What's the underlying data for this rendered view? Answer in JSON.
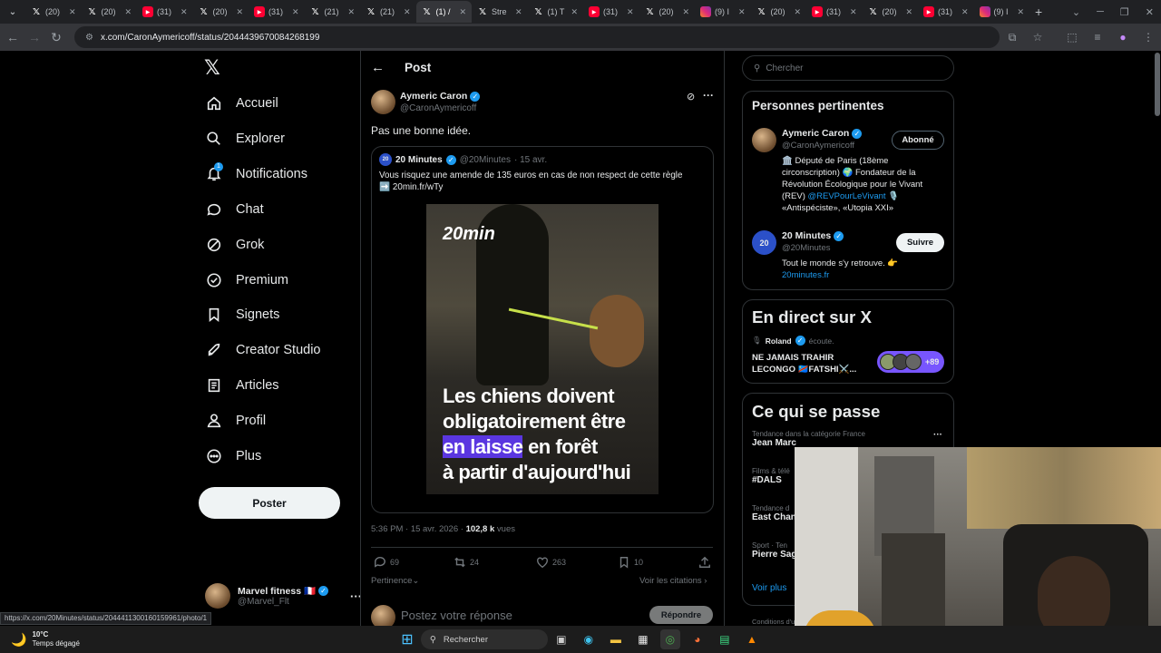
{
  "browser": {
    "tabs": [
      {
        "label": "(20)",
        "favicon": "chevron-icon"
      },
      {
        "label": "(20)",
        "favicon": "x-logo-icon"
      },
      {
        "label": "(20)",
        "favicon": "x-logo-icon"
      },
      {
        "label": "(31)",
        "favicon": "youtube-icon"
      },
      {
        "label": "(20)",
        "favicon": "x-logo-icon"
      },
      {
        "label": "(31)",
        "favicon": "youtube-icon"
      },
      {
        "label": "(21)",
        "favicon": "x-logo-icon"
      },
      {
        "label": "(21)",
        "favicon": "x-logo-icon"
      },
      {
        "label": "(1) /",
        "favicon": "x-logo-icon",
        "active": true
      },
      {
        "label": "Stre",
        "favicon": "x-logo-icon"
      },
      {
        "label": "(1) T",
        "favicon": "x-logo-icon"
      },
      {
        "label": "(31)",
        "favicon": "youtube-icon"
      },
      {
        "label": "(20)",
        "favicon": "x-logo-icon"
      },
      {
        "label": "(9) I",
        "favicon": "instagram-icon"
      },
      {
        "label": "(20)",
        "favicon": "x-logo-icon"
      },
      {
        "label": "(31)",
        "favicon": "youtube-icon"
      },
      {
        "label": "(20)",
        "favicon": "x-logo-icon"
      },
      {
        "label": "(31)",
        "favicon": "youtube-icon"
      },
      {
        "label": "(9) I",
        "favicon": "instagram-icon"
      }
    ],
    "url": "x.com/CaronAymericoff/status/2044439670084268199",
    "status_url": "https://x.com/20Minutes/status/2044411300160159961/photo/1"
  },
  "nav": {
    "items": [
      {
        "label": "Accueil",
        "icon": "home-icon"
      },
      {
        "label": "Explorer",
        "icon": "search-icon"
      },
      {
        "label": "Notifications",
        "icon": "bell-icon",
        "badge": "1"
      },
      {
        "label": "Chat",
        "icon": "chat-icon"
      },
      {
        "label": "Grok",
        "icon": "grok-icon"
      },
      {
        "label": "Premium",
        "icon": "premium-icon"
      },
      {
        "label": "Signets",
        "icon": "bookmark-icon"
      },
      {
        "label": "Creator Studio",
        "icon": "rocket-icon"
      },
      {
        "label": "Articles",
        "icon": "article-icon"
      },
      {
        "label": "Profil",
        "icon": "person-icon"
      },
      {
        "label": "Plus",
        "icon": "more-circle-icon"
      }
    ],
    "post_button": "Poster",
    "account": {
      "name": "Marvel fitness 🇫🇷",
      "handle": "@Marvel_Flt"
    }
  },
  "post": {
    "header": "Post",
    "author": {
      "name": "Aymeric Caron",
      "handle": "@CaronAymericoff"
    },
    "text": "Pas une bonne idée.",
    "quote": {
      "name": "20 Minutes",
      "handle": "@20Minutes",
      "date": "· 15 avr.",
      "text": "Vous risquez une amende de 135 euros en cas de non respect de cette règle",
      "link": "➡️ 20min.fr/wTy",
      "image": {
        "logo": "20min",
        "line1": "Les chiens doivent",
        "line2": "obligatoirement être",
        "line3_highlight": "en laisse",
        "line3_rest": " en forêt",
        "line4": "à partir d'aujourd'hui"
      }
    },
    "meta": {
      "time": "5:36 PM · 15 avr. 2026 · ",
      "views": "102,8 k",
      "views_label": " vues"
    },
    "stats": {
      "replies": "69",
      "reposts": "24",
      "likes": "263",
      "bookmarks": "10"
    },
    "sort": "Pertinence",
    "quotes_link": "Voir les citations",
    "reply_placeholder": "Postez votre réponse",
    "reply_button": "Répondre"
  },
  "sidebar": {
    "search_placeholder": "Chercher",
    "relevant": {
      "title": "Personnes pertinentes",
      "people": [
        {
          "name": "Aymeric Caron",
          "handle": "@CaronAymericoff",
          "button": "Abonné",
          "bio1": "🏛️ Député de Paris (18ème circonscription) 🌍 Fondateur de la Révolution Écologique pour le Vivant (REV) ",
          "bio_link": "@REVPourLeVivant",
          "bio2": " 🎙️ «Antispéciste», «Utopia XXI»"
        },
        {
          "name": "20 Minutes",
          "handle": "@20Minutes",
          "button": "Suivre",
          "bio1": "Tout le monde s'y retrouve. 👉",
          "bio_link": "20minutes.fr"
        }
      ]
    },
    "live": {
      "title": "En direct sur X",
      "host": "Roland",
      "host_status": "écoute.",
      "space_title_1": "NE JAMAIS TRAHIR",
      "space_title_2": "LECONGO 🇨🇩FATSHI⚔️...",
      "listeners": "+89"
    },
    "trends": {
      "title": "Ce qui se passe",
      "items": [
        {
          "category": "Tendance dans la catégorie France",
          "name": "Jean Marc"
        },
        {
          "category": "Films & télé",
          "name": "#DALS"
        },
        {
          "category": "Tendance d",
          "name": "East Chan"
        },
        {
          "category": "Sport · Ten",
          "name": "Pierre Sag"
        }
      ],
      "more": "Voir plus",
      "footer": "Conditions d'u"
    }
  },
  "taskbar": {
    "weather_temp": "10°C",
    "weather_desc": "Temps dégagé",
    "search": "Rechercher"
  }
}
